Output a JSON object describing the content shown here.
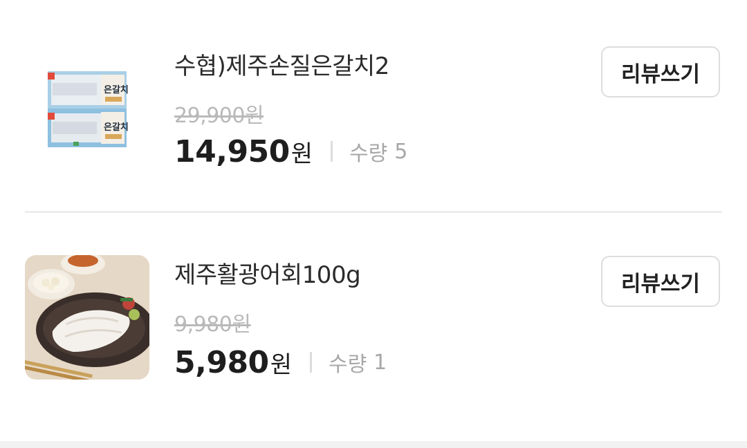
{
  "items": [
    {
      "name": "수협)제주손질은갈치2",
      "original_price": "29,900원",
      "price": "14,950",
      "currency": "원",
      "quantity_label": "수량",
      "quantity": "5",
      "review_button": "리뷰쓰기",
      "image_icon": "silver-hairtail-package-image",
      "package_label_1": "은갈치",
      "package_label_2": "은갈치"
    },
    {
      "name": "제주활광어회100g",
      "original_price": "9,980원",
      "price": "5,980",
      "currency": "원",
      "quantity_label": "수량",
      "quantity": "1",
      "review_button": "리뷰쓰기",
      "image_icon": "flatfish-sashimi-plate-image"
    }
  ]
}
